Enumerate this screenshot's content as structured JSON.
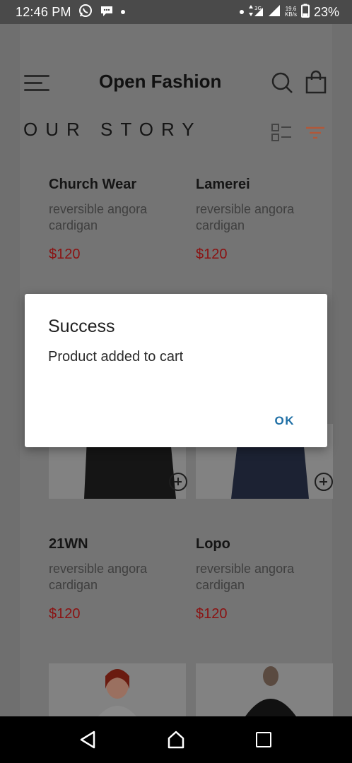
{
  "status_bar": {
    "time": "12:46 PM",
    "battery": "23%",
    "network": "3G",
    "speed_top": "19.6",
    "speed_bottom": "KB/s",
    "icons": [
      "whatsapp-icon",
      "chat-icon",
      "notification-dot-icon",
      "data-arrows-icon",
      "signal-icon",
      "battery-icon"
    ]
  },
  "header": {
    "title": "Open Fashion",
    "icons": [
      "menu-icon",
      "search-icon",
      "shopping-bag-icon"
    ]
  },
  "section": {
    "title": "OUR STORY",
    "icons": [
      "list-view-icon",
      "filter-icon"
    ]
  },
  "products": [
    {
      "name": "Church Wear",
      "description": "reversible angora cardigan",
      "price": "$120"
    },
    {
      "name": "Lamerei",
      "description": "reversible angora cardigan",
      "price": "$120"
    },
    {
      "name": "21WN",
      "description": "reversible angora cardigan",
      "price": "$120"
    },
    {
      "name": "Lopo",
      "description": "reversible angora cardigan",
      "price": "$120"
    }
  ],
  "dialog": {
    "title": "Success",
    "message": "Product added to cart",
    "ok_label": "OK"
  },
  "colors": {
    "price": "#8b1212",
    "accent": "#1f6fa5",
    "filter": "#c05a3a"
  },
  "nav_bar": {
    "icons": [
      "back-icon",
      "home-icon",
      "recents-icon"
    ]
  }
}
